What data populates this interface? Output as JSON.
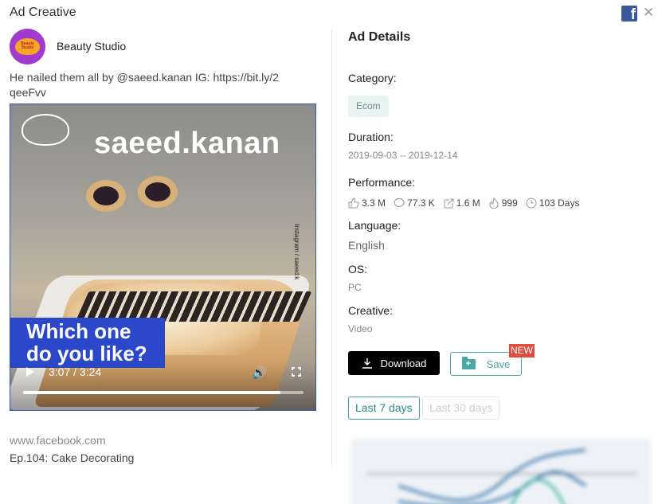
{
  "window": {
    "title": "Ad Creative",
    "close_symbol": "✕",
    "platform_icon": "facebook-icon"
  },
  "advertiser": {
    "name": "Beauty Studio",
    "avatar_text": "Beauty Studio"
  },
  "caption": "He nailed them all by @saeed.kanan IG: https://bit.ly/2 qeeFvv",
  "video": {
    "overlay_title": "saeed.kanan",
    "side_text": "Instagram / saeed.k",
    "question_line1": "Which one",
    "question_line2": "do you like?",
    "time": "3:07 / 3:24",
    "progress_fraction": 0.918
  },
  "source": "www.facebook.com",
  "episode": "Ep.104: Cake Decorating",
  "details": {
    "title": "Ad Details",
    "category_label": "Category:",
    "category_value": "Ecom",
    "duration_label": "Duration:",
    "duration_value": "2019-09-03 -- 2019-12-14",
    "performance_label": "Performance:",
    "performance": {
      "likes": "3.3 M",
      "comments": "77.3 K",
      "shares": "1.6 M",
      "popularity": "999",
      "days": "103 Days"
    },
    "language_label": "Language:",
    "language_value": "English",
    "os_label": "OS:",
    "os_value": "PC",
    "creative_label": "Creative:",
    "creative_value": "Video"
  },
  "actions": {
    "download": "Download",
    "save": "Save",
    "new_badge": "NEW"
  },
  "ranges": {
    "last7": "Last 7 days",
    "last30": "Last 30 days"
  },
  "colors": {
    "accent": "#3e9e99",
    "facebook": "#3b5998",
    "new_badge": "#e04c3e",
    "question_bg": "#2a48c9"
  }
}
